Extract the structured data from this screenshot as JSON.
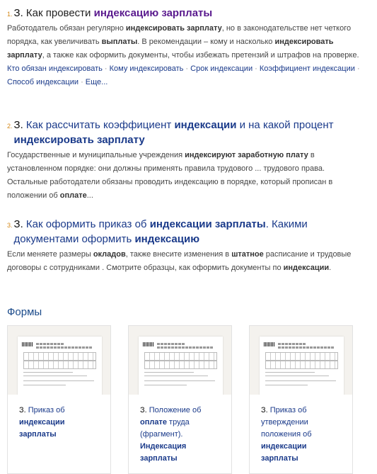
{
  "results": [
    {
      "num": "1.",
      "title_parts": [
        {
          "t": "З.",
          "style": "doc"
        },
        {
          "t": " Как провести ",
          "style": "plain"
        },
        {
          "t": "индексацию зарплаты",
          "style": "bold"
        }
      ],
      "snippet_parts": [
        {
          "t": " Работодатель обязан регулярно ",
          "style": "plain"
        },
        {
          "t": "индексировать зарплату",
          "style": "bold"
        },
        {
          "t": ", но в законодательстве нет четкого порядка, как увеличивать ",
          "style": "plain"
        },
        {
          "t": "выплаты",
          "style": "bold"
        },
        {
          "t": ". В рекомендации – кому и насколько ",
          "style": "plain"
        },
        {
          "t": "индексировать зарплату",
          "style": "bold"
        },
        {
          "t": ", а также как оформить документы, чтобы избежать претензий и штрафов на проверке.",
          "style": "plain"
        }
      ],
      "links": [
        "Кто обязан индексировать",
        "Кому индексировать",
        "Срок индексации",
        "Коэффициент индексации",
        "Способ индексации",
        "Еще..."
      ]
    },
    {
      "num": "2.",
      "title_parts": [
        {
          "t": "З.",
          "style": "doc"
        },
        {
          "t": " Как рассчитать коэффициент ",
          "style": "plain"
        },
        {
          "t": "индексации",
          "style": "bold"
        },
        {
          "t": " и на какой процент ",
          "style": "plain"
        },
        {
          "t": "индексировать зарплату",
          "style": "bold"
        }
      ],
      "snippet_parts": [
        {
          "t": "Государственные и муниципальные учреждения ",
          "style": "plain"
        },
        {
          "t": "индексируют заработную плату",
          "style": "bold"
        },
        {
          "t": " в установленном порядке: они должны применять правила трудового ... трудового права. Остальные работодатели обязаны проводить индексацию в порядке, который прописан в положении об ",
          "style": "plain"
        },
        {
          "t": "оплате",
          "style": "bold"
        },
        {
          "t": "...",
          "style": "plain"
        }
      ]
    },
    {
      "num": "3.",
      "title_parts": [
        {
          "t": "З.",
          "style": "doc"
        },
        {
          "t": " Как оформить приказ об ",
          "style": "plain"
        },
        {
          "t": "индексации зарплаты",
          "style": "bold"
        },
        {
          "t": ". Какими документами оформить ",
          "style": "plain"
        },
        {
          "t": "индексацию",
          "style": "bold"
        }
      ],
      "snippet_parts": [
        {
          "t": "Если меняете размеры ",
          "style": "plain"
        },
        {
          "t": "окладов",
          "style": "bold"
        },
        {
          "t": ", также внесите изменения в ",
          "style": "plain"
        },
        {
          "t": "штатное",
          "style": "bold"
        },
        {
          "t": " расписание и трудовые договоры с сотрудниками . Смотрите образцы, как оформить документы по ",
          "style": "plain"
        },
        {
          "t": "индексации",
          "style": "bold"
        },
        {
          "t": ".",
          "style": "plain"
        }
      ]
    }
  ],
  "forms_title": "Формы",
  "cards": [
    {
      "parts": [
        {
          "t": "З.",
          "style": "doc"
        },
        {
          "t": " Приказ об ",
          "style": "plain"
        },
        {
          "t": "индексации зарплаты",
          "style": "bold"
        }
      ]
    },
    {
      "parts": [
        {
          "t": "З.",
          "style": "doc"
        },
        {
          "t": " Положение об ",
          "style": "plain"
        },
        {
          "t": "оплате",
          "style": "bold"
        },
        {
          "t": " труда (фрагмент). ",
          "style": "plain"
        },
        {
          "t": "Индексация зарплаты",
          "style": "bold"
        }
      ]
    },
    {
      "parts": [
        {
          "t": "З.",
          "style": "doc"
        },
        {
          "t": " Приказ об утверждении положения об ",
          "style": "plain"
        },
        {
          "t": "индексации зарплаты",
          "style": "bold"
        }
      ]
    }
  ],
  "colors": {
    "accent": "#1a3a8a",
    "number": "#d4891a",
    "visited": "#5a1a8e"
  }
}
